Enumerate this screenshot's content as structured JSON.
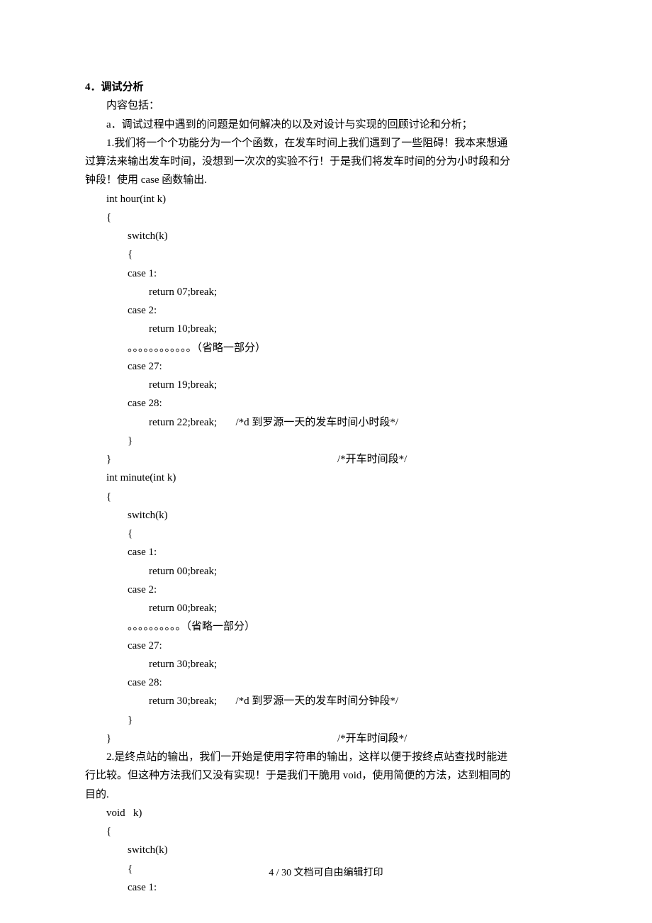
{
  "section": {
    "heading": "4．调试分析",
    "intro": "内容包括：",
    "item_a": "a．调试过程中遇到的问题是如何解决的以及对设计与实现的回顾讨论和分析；",
    "para1": {
      "l1": "1.我们将一个个功能分为一个个函数，在发车时间上我们遇到了一些阻碍！我本来想通",
      "l2": "过算法来输出发车时间，没想到一次次的实验不行！于是我们将发车时间的分为小时段和分",
      "l3": "钟段！使用 case 函数输出."
    },
    "para2": {
      "l1": "2.是终点站的输出，我们一开始是使用字符串的输出，这样以便于按终点站查找时能进",
      "l2": "行比较。但这种方法我们又没有实现！于是我们干脆用 void，使用简便的方法，达到相同的",
      "l3": "目的."
    }
  },
  "code": {
    "brace_open": "{",
    "brace_close": "}",
    "switch": "switch(k)",
    "case1": "case 1:",
    "case2": "case 2:",
    "case27": "case 27:",
    "case28": "case 28:",
    "omit12": "。。。。。。。。。。。。（省略一部分）",
    "omit10": "。。。。。。。。。。（省略一部分）",
    "hour": {
      "sig": "int hour(int k)",
      "ret1": "return 07;break;",
      "ret2": "return 10;break;",
      "ret27": "return 19;break;",
      "ret28": "return 22;break;       /*d 到罗源一天的发车时间小时段*/",
      "close": "}                                                                                     /*开车时间段*/"
    },
    "minute": {
      "sig": "int minute(int k)",
      "ret1": "return 00;break;",
      "ret2": "return 00;break;",
      "ret27": "return 30;break;",
      "ret28": "return 30;break;       /*d 到罗源一天的发车时间分钟段*/",
      "close": "}                                                                                     /*开车时间段*/"
    },
    "voidk": {
      "sig": "void   k)"
    }
  },
  "footer": {
    "text": "4 / 30 文档可自由编辑打印"
  }
}
